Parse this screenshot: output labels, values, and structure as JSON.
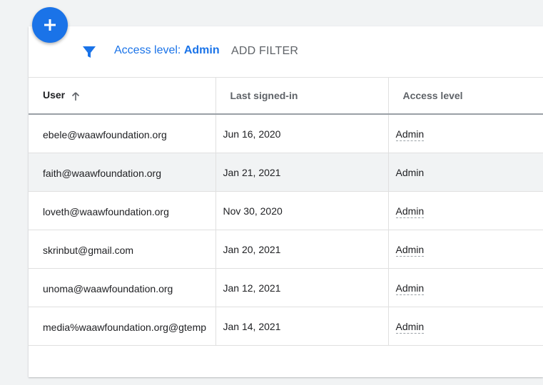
{
  "fab": {
    "icon": "plus-icon"
  },
  "toolbar": {
    "filter_icon": "filter-icon",
    "chip_label": "Access level: ",
    "chip_value": "Admin",
    "add_filter_label": "ADD FILTER"
  },
  "table": {
    "columns": [
      "User",
      "Last signed-in",
      "Access level"
    ],
    "sort_icon": "arrow-up-icon",
    "rows": [
      {
        "user": "ebele@waawfoundation.org",
        "last_signed_in": "Jun 16, 2020",
        "access": "Admin"
      },
      {
        "user": "faith@waawfoundation.org",
        "last_signed_in": "Jan 21, 2021",
        "access": "Admin"
      },
      {
        "user": "loveth@waawfoundation.org",
        "last_signed_in": "Nov 30, 2020",
        "access": "Admin"
      },
      {
        "user": "skrinbut@gmail.com",
        "last_signed_in": "Jan 20, 2021",
        "access": "Admin"
      },
      {
        "user": "unoma@waawfoundation.org",
        "last_signed_in": "Jan 12, 2021",
        "access": "Admin"
      },
      {
        "user": "media%waawfoundation.org@gtemp",
        "last_signed_in": "Jan 14, 2021",
        "access": "Admin"
      }
    ]
  },
  "colors": {
    "accent": "#1a73e8",
    "hover_row": "#f1f3f4"
  }
}
